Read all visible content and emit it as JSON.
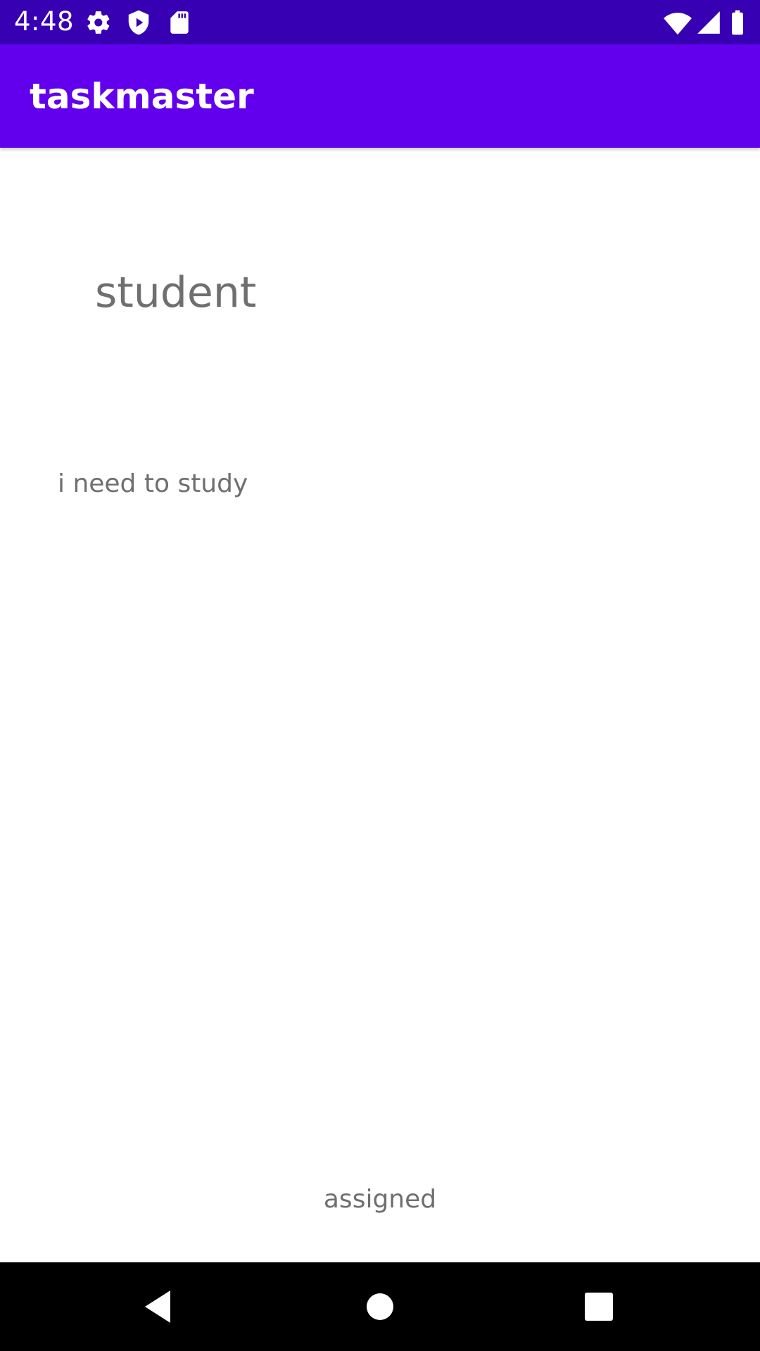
{
  "status_bar": {
    "time": "4:48",
    "icons": [
      "gear-icon",
      "shield-play-icon",
      "sd-card-icon",
      "wifi-icon",
      "signal-icon",
      "battery-icon"
    ],
    "background": "#3700b3"
  },
  "app_bar": {
    "title": "taskmaster",
    "background": "#6200ee"
  },
  "task": {
    "title": "student",
    "body": "i need to study",
    "state": "assigned"
  },
  "nav_bar": {
    "buttons": [
      "back-icon",
      "home-icon",
      "recents-icon"
    ]
  }
}
